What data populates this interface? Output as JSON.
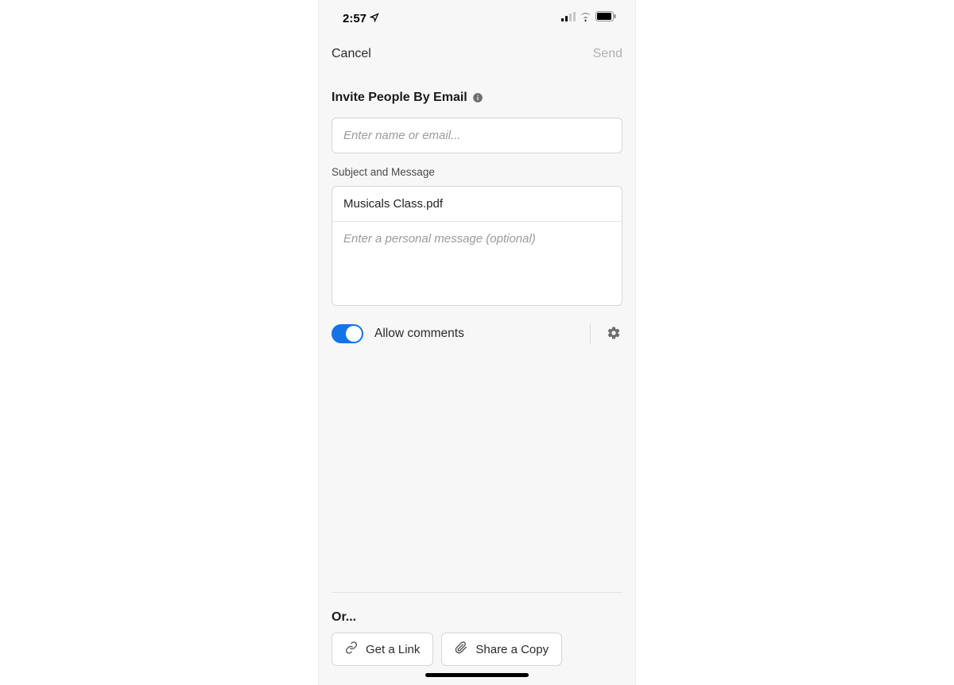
{
  "status": {
    "time": "2:57",
    "location_icon": "location-arrow-icon",
    "signal_icon": "cellular-signal-icon",
    "wifi_icon": "wifi-icon",
    "battery_icon": "battery-icon"
  },
  "nav": {
    "cancel_label": "Cancel",
    "send_label": "Send"
  },
  "invite": {
    "title": "Invite People By Email",
    "info_icon": "info-icon",
    "email_placeholder": "Enter name or email...",
    "subject_section_label": "Subject and Message",
    "subject_value": "Musicals Class.pdf",
    "message_placeholder": "Enter a personal message (optional)"
  },
  "options": {
    "allow_comments_label": "Allow comments",
    "allow_comments_on": true,
    "gear_icon": "gear-icon"
  },
  "alt": {
    "or_label": "Or...",
    "get_link_label": "Get a Link",
    "share_copy_label": "Share a Copy",
    "link_icon": "link-icon",
    "attach_icon": "paperclip-icon"
  }
}
